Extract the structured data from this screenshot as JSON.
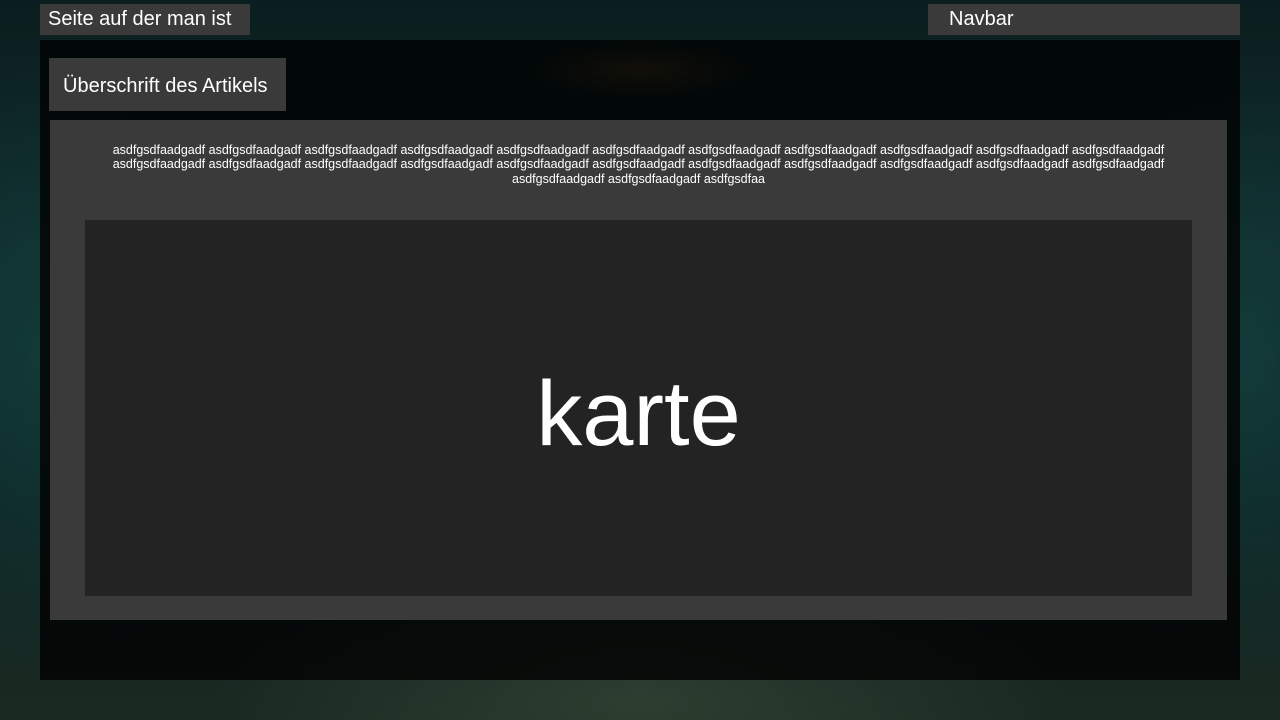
{
  "header": {
    "current_page_label": "Seite auf der man ist",
    "navbar_label": "Navbar"
  },
  "article": {
    "heading": "Überschrift des Artikels",
    "body_text": "asdfgsdfaadgadf asdfgsdfaadgadf asdfgsdfaadgadf asdfgsdfaadgadf asdfgsdfaadgadf asdfgsdfaadgadf asdfgsdfaadgadf asdfgsdfaadgadf asdfgsdfaadgadf asdfgsdfaadgadf asdfgsdfaadgadf asdfgsdfaadgadf asdfgsdfaadgadf asdfgsdfaadgadf asdfgsdfaadgadf asdfgsdfaadgadf asdfgsdfaadgadf asdfgsdfaadgadf asdfgsdfaadgadf asdfgsdfaadgadf asdfgsdfaadgadf asdfgsdfaadgadf asdfgsdfaadgadf asdfgsdfaadgadf asdfgsdfaa",
    "map_label": "karte"
  },
  "colors": {
    "panel": "#3a3a3a",
    "map_box": "#232323",
    "overlay": "#000000",
    "text": "#ffffff"
  }
}
